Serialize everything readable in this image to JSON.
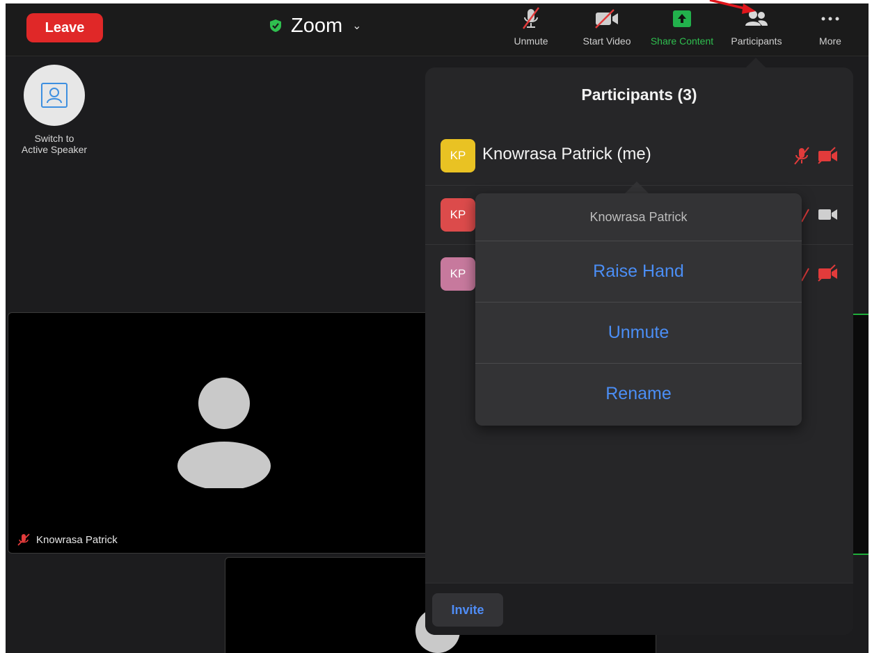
{
  "toolbar": {
    "leave_label": "Leave",
    "app_title": "Zoom",
    "unmute_label": "Unmute",
    "start_video_label": "Start Video",
    "share_content_label": "Share Content",
    "participants_label": "Participants",
    "more_label": "More"
  },
  "left": {
    "switch_label_line1": "Switch to",
    "switch_label_line2": "Active Speaker",
    "main_video_name": "Knowrasa Patrick"
  },
  "panel": {
    "title": "Participants (3)",
    "participants": [
      {
        "initials": "KP",
        "name": "Knowrasa Patrick (me)",
        "avatar_color": "#e9c223"
      },
      {
        "initials": "KP",
        "name": "",
        "avatar_color": "#dc4b4b"
      },
      {
        "initials": "KP",
        "name": "",
        "avatar_color": "#c7799d"
      }
    ],
    "invite_label": "Invite"
  },
  "popover": {
    "title": "Knowrasa Patrick",
    "items": [
      "Raise Hand",
      "Unmute",
      "Rename"
    ]
  },
  "colors": {
    "accent_blue": "#4b8ef5",
    "leave_red": "#e02828",
    "share_green": "#22b14c",
    "muted_red": "#e23b3b"
  }
}
